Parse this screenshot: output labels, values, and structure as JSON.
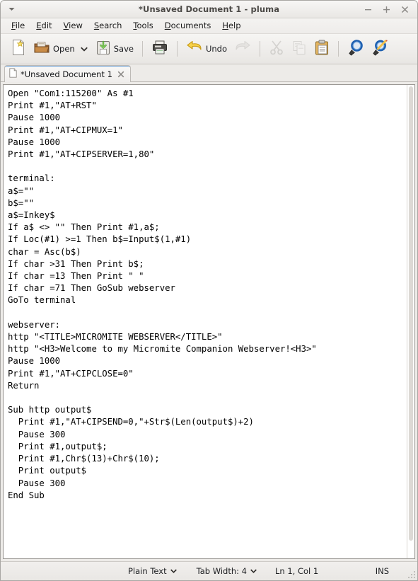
{
  "window": {
    "title": "*Unsaved Document 1 - pluma",
    "menu_arrow_icon": "chevron-down-icon",
    "controls": [
      {
        "name": "minimize-button",
        "icon": "minimize-icon",
        "label": "−"
      },
      {
        "name": "maximize-button",
        "icon": "maximize-icon",
        "label": "+"
      },
      {
        "name": "close-button",
        "icon": "close-icon",
        "label": "✕"
      }
    ]
  },
  "menubar": {
    "items": [
      {
        "label": "File",
        "mnemonic": "F",
        "rest": "ile"
      },
      {
        "label": "Edit",
        "mnemonic": "E",
        "rest": "dit"
      },
      {
        "label": "View",
        "mnemonic": "V",
        "rest": "iew"
      },
      {
        "label": "Search",
        "mnemonic": "S",
        "rest": "earch"
      },
      {
        "label": "Tools",
        "mnemonic": "T",
        "rest": "ools"
      },
      {
        "label": "Documents",
        "mnemonic": "D",
        "rest": "ocuments"
      },
      {
        "label": "Help",
        "mnemonic": "H",
        "rest": "elp"
      }
    ]
  },
  "toolbar": {
    "new_label": "",
    "new_icon": "new-document-icon",
    "open_label": "Open",
    "open_icon": "open-folder-icon",
    "open_dropdown_icon": "chevron-down-icon",
    "save_label": "Save",
    "save_icon": "save-disk-icon",
    "print_label": "",
    "print_icon": "printer-icon",
    "undo_label": "Undo",
    "undo_icon": "undo-arrow-icon",
    "redo_label": "",
    "redo_icon": "redo-arrow-icon",
    "cut_icon": "scissors-icon",
    "copy_icon": "copy-icon",
    "paste_icon": "clipboard-paste-icon",
    "find_icon": "magnifier-search-icon",
    "replace_icon": "magnifier-replace-icon"
  },
  "tabs": [
    {
      "title": "*Unsaved Document 1",
      "icon": "document-icon",
      "close_icon": "close-icon",
      "close_label": "✕",
      "active": true
    }
  ],
  "editor": {
    "content": "Open \"Com1:115200\" As #1\nPrint #1,\"AT+RST\"\nPause 1000\nPrint #1,\"AT+CIPMUX=1\"\nPause 1000\nPrint #1,\"AT+CIPSERVER=1,80\"\n\nterminal:\na$=\"\"\nb$=\"\"\na$=Inkey$\nIf a$ <> \"\" Then Print #1,a$;\nIf Loc(#1) >=1 Then b$=Input$(1,#1)\nchar = Asc(b$)\nIf char >31 Then Print b$;\nIf char =13 Then Print \" \"\nIf char =71 Then GoSub webserver\nGoTo terminal\n\nwebserver:\nhttp \"<TITLE>MICROMITE WEBSERVER</TITLE>\"\nhttp \"<H3>Welcome to my Micromite Companion Webserver!<H3>\"\nPause 1000\nPrint #1,\"AT+CIPCLOSE=0\"\nReturn\n\nSub http output$\n  Print #1,\"AT+CIPSEND=0,\"+Str$(Len(output$)+2)\n  Pause 300\n  Print #1,output$;\n  Print #1,Chr$(13)+Chr$(10);\n  Print output$\n  Pause 300\nEnd Sub"
  },
  "statusbar": {
    "language": "Plain Text",
    "language_caret": "⌄",
    "tab_width": "Tab Width: 4",
    "tab_width_caret": "⌄",
    "cursor_position": "Ln 1, Col 1",
    "insert_mode": "INS"
  },
  "colors": {
    "titlebar_text": "#4a4845",
    "chrome_bg": "#eceae8",
    "editor_bg": "#ffffff",
    "code_text": "#000000",
    "tab_active_accent": "#6c9fd4"
  }
}
